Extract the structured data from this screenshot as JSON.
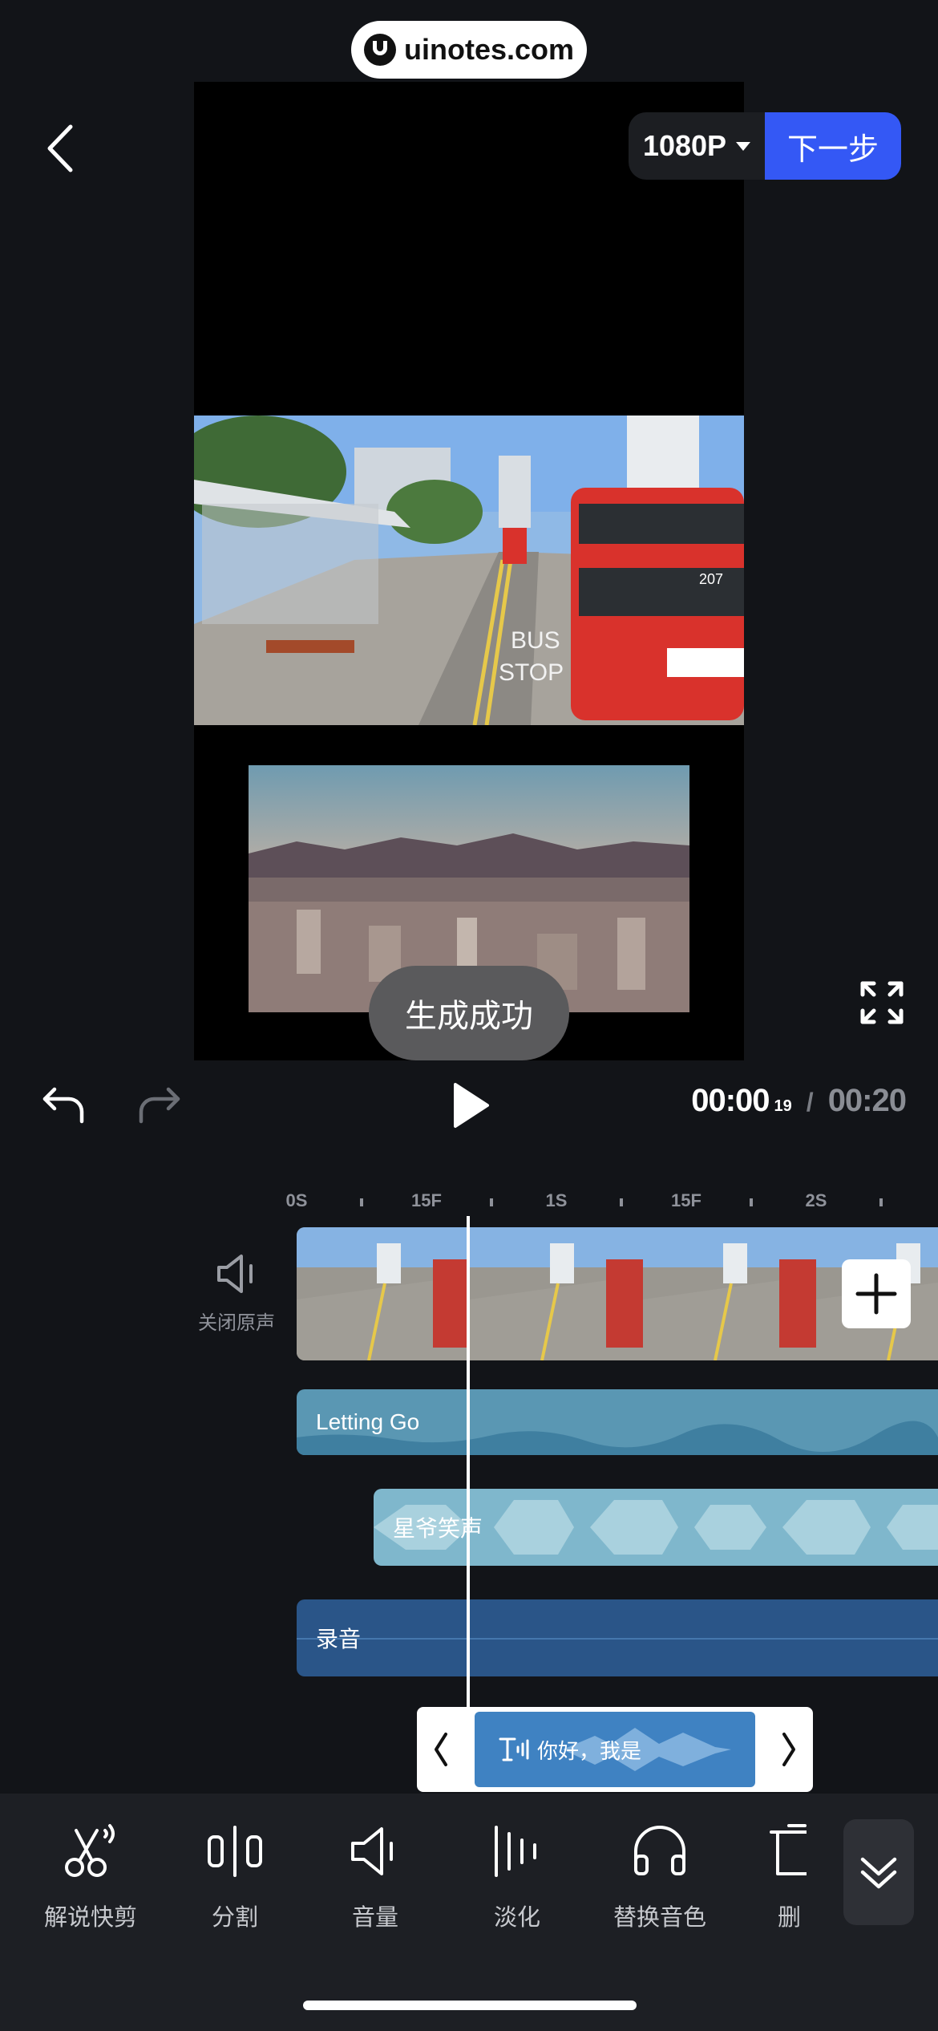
{
  "watermark": "uinotes.com",
  "header": {
    "resolution": "1080P",
    "next_label": "下一步"
  },
  "toast": "生成成功",
  "playback": {
    "current": "00:00",
    "current_frame": "19",
    "separator": "/",
    "total": "00:20"
  },
  "ruler": [
    "0S",
    "15F",
    "1S",
    "15F",
    "2S"
  ],
  "tracks": {
    "mute_label": "关闭原声",
    "music": "Letting Go",
    "sfx": "星爷笑声",
    "recording": "录音",
    "tts": "你好，我是"
  },
  "toolbar": {
    "items": [
      "解说快剪",
      "分割",
      "音量",
      "淡化",
      "替换音色",
      "删"
    ]
  },
  "icons": [
    "back-icon",
    "caret-down-icon",
    "fullscreen-icon",
    "undo-icon",
    "redo-icon",
    "play-icon",
    "speaker-icon",
    "plus-icon",
    "text-to-speech-icon",
    "scissors-icon",
    "split-icon",
    "volume-icon",
    "fade-icon",
    "headphones-icon",
    "delete-icon",
    "double-chevron-down-icon"
  ],
  "colors": {
    "accent": "#3458f5",
    "music": "#5a97b3",
    "sfx": "#7fb7cc",
    "recording": "#2a5588"
  }
}
